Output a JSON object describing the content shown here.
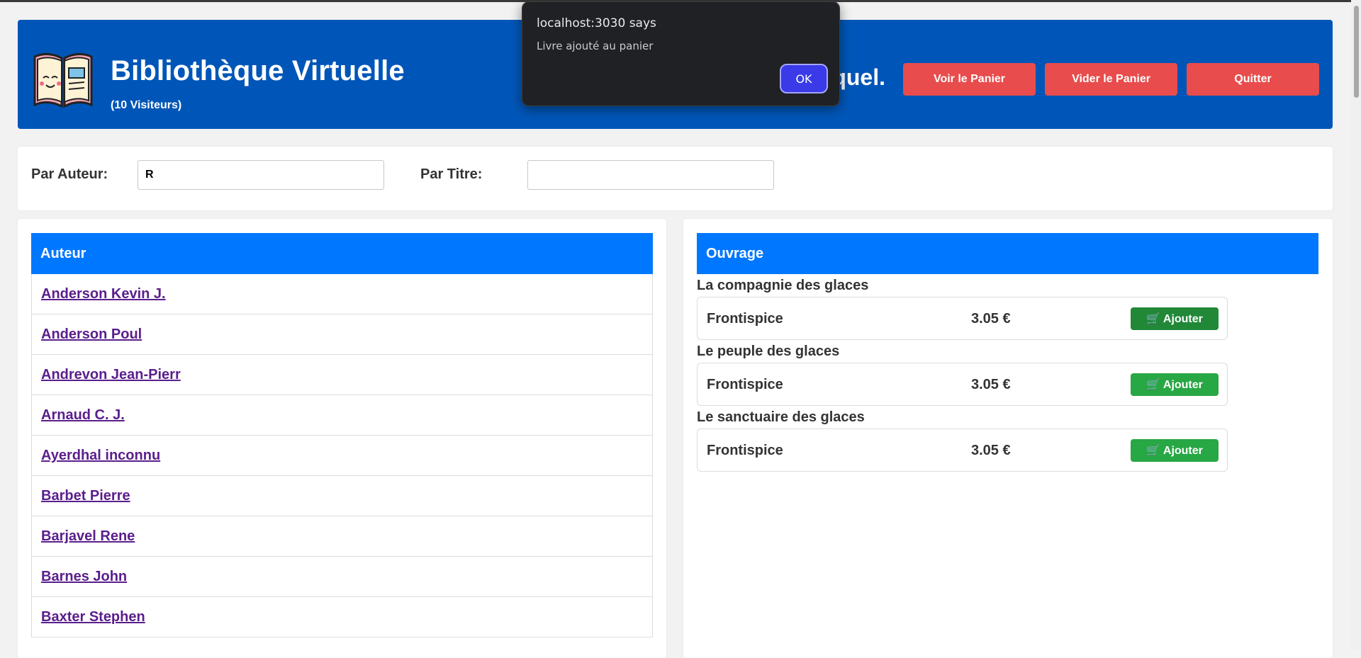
{
  "header": {
    "title": "Bibliothèque Virtuelle",
    "visitors": "(10 Visiteurs)",
    "greeting_fragment": "aquel.",
    "buttons": {
      "view_cart": "Voir le Panier",
      "empty_cart": "Vider le Panier",
      "quit": "Quitter"
    },
    "logo_icon": "book-icon"
  },
  "filters": {
    "author_label": "Par Auteur:",
    "author_value": "R",
    "title_label": "Par Titre:",
    "title_value": ""
  },
  "authors": {
    "header": "Auteur",
    "items": [
      "Anderson Kevin J.",
      "Anderson Poul",
      "Andrevon Jean-Pierr",
      "Arnaud C. J.",
      "Ayerdhal inconnu",
      "Barbet Pierre",
      "Barjavel Rene",
      "Barnes John",
      "Baxter Stephen"
    ]
  },
  "works": {
    "header": "Ouvrage",
    "items": [
      {
        "title": "La compagnie des glaces",
        "edition": "Frontispice",
        "price": "3.05 €",
        "button": "🛒 Ajouter"
      },
      {
        "title": "Le peuple des glaces",
        "edition": "Frontispice",
        "price": "3.05 €",
        "button": "🛒 Ajouter"
      },
      {
        "title": "Le sanctuaire des glaces",
        "edition": "Frontispice",
        "price": "3.05 €",
        "button": "🛒 Ajouter"
      }
    ]
  },
  "dialog": {
    "title": "localhost:3030 says",
    "message": "Livre ajouté au panier",
    "ok": "OK"
  },
  "colors": {
    "header_bg": "#0056b8",
    "table_header": "#0077ff",
    "danger": "#e84c4c",
    "success": "#28a745",
    "link": "#5a1e8c",
    "dialog_bg": "#202124",
    "dialog_button": "#3a3ae8"
  }
}
